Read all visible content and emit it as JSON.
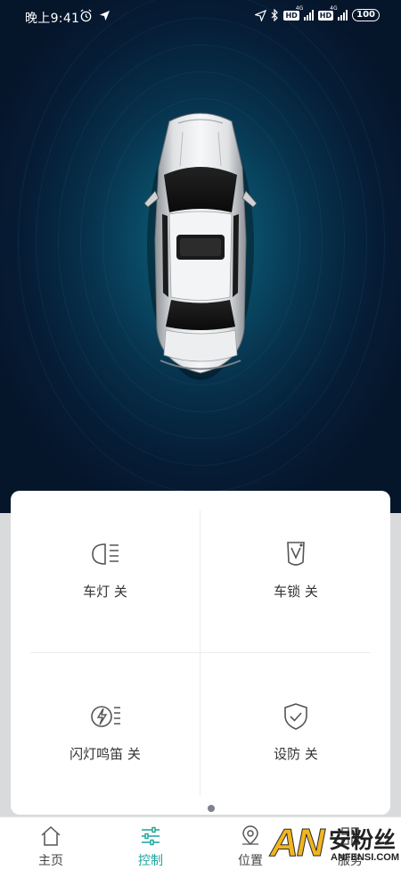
{
  "status_bar": {
    "time": "晚上9:41",
    "hd1": "HD",
    "net1": "4G",
    "hd2": "HD",
    "net2": "4G",
    "battery": "100"
  },
  "controls": [
    {
      "label": "车灯 关",
      "icon": "headlight-icon"
    },
    {
      "label": "车锁 关",
      "icon": "car-lock-icon"
    },
    {
      "label": "闪灯鸣笛 关",
      "icon": "flash-horn-icon"
    },
    {
      "label": "设防 关",
      "icon": "shield-check-icon"
    }
  ],
  "nav": [
    {
      "label": "主页",
      "icon": "home-icon",
      "active": false
    },
    {
      "label": "控制",
      "icon": "sliders-icon",
      "active": true
    },
    {
      "label": "位置",
      "icon": "location-pin-icon",
      "active": false
    },
    {
      "label": "服务",
      "icon": "grid-icon",
      "active": false
    }
  ],
  "watermark": {
    "logo": "AN",
    "text": "安粉丝",
    "url": "ANFENSI.COM"
  },
  "colors": {
    "accent": "#1aa49a",
    "hero_bg": "#061d36",
    "hero_glow": "#0f6f8a"
  }
}
